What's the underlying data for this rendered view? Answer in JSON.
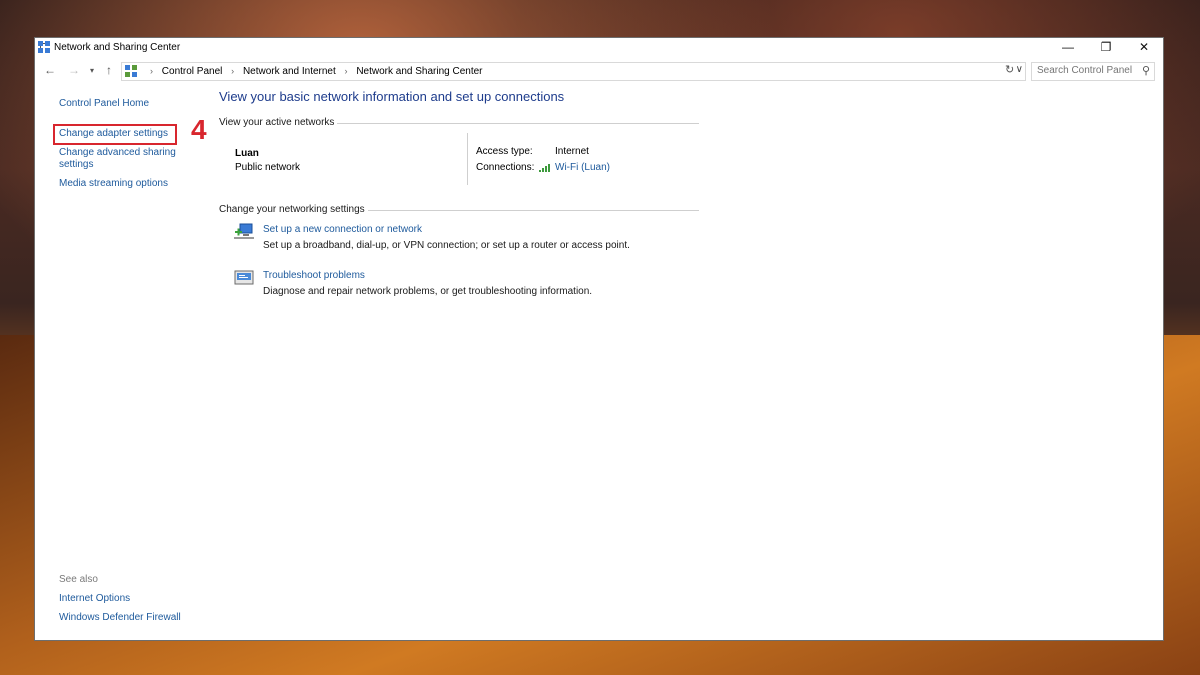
{
  "window": {
    "title": "Network and Sharing Center",
    "controls": {
      "minimize": "—",
      "maximize": "❐",
      "close": "✕"
    }
  },
  "nav": {
    "back": "←",
    "forward": "→",
    "recent": "▾",
    "up": "↑"
  },
  "address": {
    "crumbs": [
      "Control Panel",
      "Network and Internet",
      "Network and Sharing Center"
    ],
    "separator": "›",
    "dropdown": "∨",
    "refresh": "↻"
  },
  "search": {
    "placeholder": "Search Control Panel",
    "icon": "⚲"
  },
  "sidebar": {
    "items": [
      {
        "label": "Control Panel Home"
      },
      {
        "label": "Change adapter settings"
      },
      {
        "label": "Change advanced sharing"
      },
      {
        "label": "settings"
      },
      {
        "label": "Media streaming options"
      }
    ],
    "see_also": "See also",
    "see_also_items": [
      {
        "label": "Internet Options"
      },
      {
        "label": "Windows Defender Firewall"
      }
    ]
  },
  "annotation": {
    "step_number": "4",
    "color": "#d8262e"
  },
  "main": {
    "title": "View your basic network information and set up connections",
    "active_networks_heading": "View your active networks",
    "network": {
      "name": "Luan",
      "type": "Public network",
      "access_label": "Access type:",
      "access_value": "Internet",
      "connections_label": "Connections:",
      "connection_link": "Wi-Fi (Luan)"
    },
    "settings_heading": "Change your networking settings",
    "tasks": [
      {
        "link": "Set up a new connection or network",
        "desc": "Set up a broadband, dial-up, or VPN connection; or set up a router or access point."
      },
      {
        "link": "Troubleshoot problems",
        "desc": "Diagnose and repair network problems, or get troubleshooting information."
      }
    ]
  },
  "colors": {
    "link": "#1e5a9c",
    "title": "#1e3c8c",
    "highlight": "#d8262e"
  }
}
